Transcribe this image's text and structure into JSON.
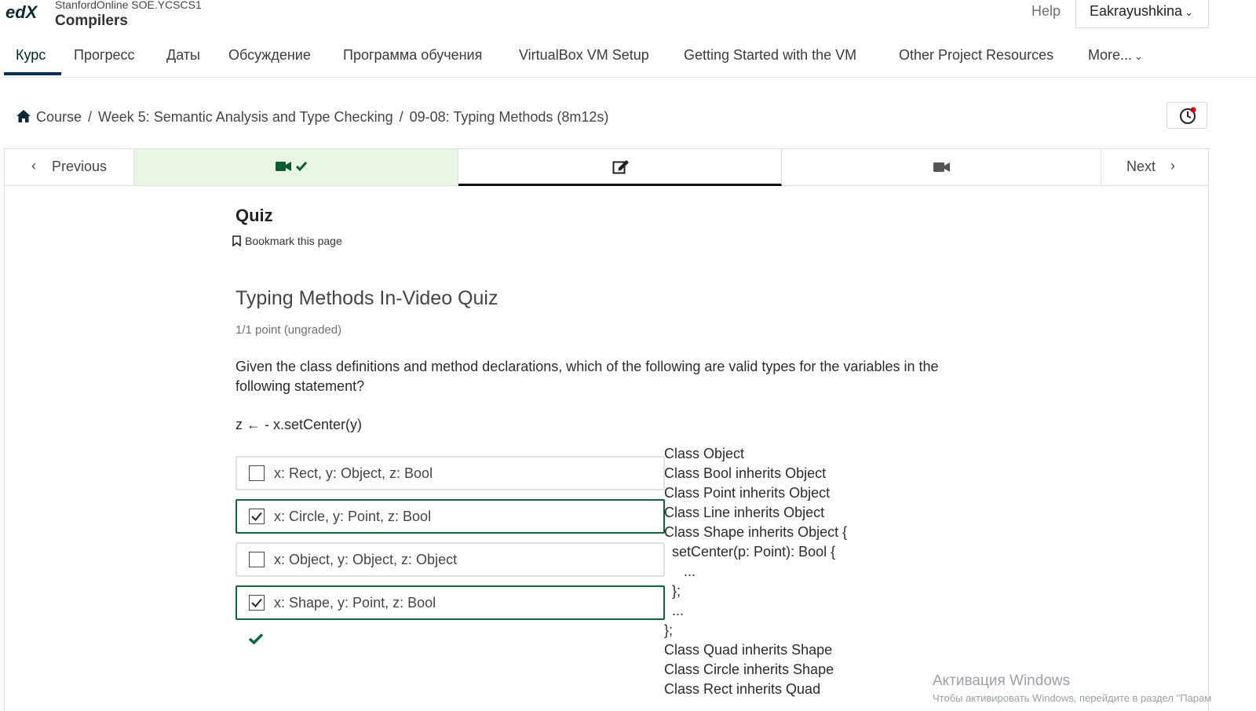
{
  "header": {
    "logo_text": "edX",
    "course_org": "StanfordOnline SOE.YCSCS1",
    "course_name": "Compilers",
    "help_label": "Help",
    "user_name": "Eakrayushkina"
  },
  "nav": {
    "tabs": [
      {
        "label": "Курс",
        "active": true
      },
      {
        "label": "Прогресс"
      },
      {
        "label": "Даты"
      },
      {
        "label": "Обсуждение"
      },
      {
        "label": "Программа обучения"
      },
      {
        "label": "VirtualBox VM Setup"
      },
      {
        "label": "Getting Started with the VM"
      },
      {
        "label": "Other Project Resources"
      },
      {
        "label": "More..."
      }
    ]
  },
  "breadcrumb": {
    "items": [
      "Course",
      "Week 5: Semantic Analysis and Type Checking",
      "09-08: Typing Methods (8m12s)"
    ],
    "separator": "/"
  },
  "sequence": {
    "previous_label": "Previous",
    "next_label": "Next",
    "units": [
      {
        "icon": "video-icon",
        "complete": true
      },
      {
        "icon": "edit-icon",
        "current": true
      },
      {
        "icon": "video-icon"
      }
    ]
  },
  "unit": {
    "title": "Quiz",
    "bookmark_label": "Bookmark this page"
  },
  "problem": {
    "title": "Typing Methods In-Video Quiz",
    "points": "1/1 point (ungraded)",
    "question": "Given the class definitions and method declarations, which of the following are valid types for the variables in the following statement?",
    "statement": "z ← - x.setCenter(y)",
    "choices": [
      {
        "label": "x: Rect, y: Object, z: Bool",
        "checked": false
      },
      {
        "label": "x: Circle, y: Point, z: Bool",
        "checked": true
      },
      {
        "label": "x: Object, y: Object, z: Object",
        "checked": false
      },
      {
        "label": "x: Shape, y: Point, z: Bool",
        "checked": true
      }
    ],
    "result": "correct",
    "code_lines": [
      "Class Object",
      "Class Bool inherits Object",
      "Class Point inherits Object",
      "Class Line inherits Object",
      "Class Shape inherits Object {",
      "  setCenter(p: Point): Bool {",
      "     ...",
      "  };",
      "  ...",
      "};",
      "Class Quad inherits Shape",
      "Class Circle inherits Shape",
      "Class Rect inherits Quad"
    ]
  },
  "colors": {
    "brand": "#00262b",
    "selected_border": "#11653a",
    "complete_bg": "#e9f6e5",
    "notification_dot": "#d0021b"
  },
  "watermark": {
    "line1": "Активация Windows",
    "line2": "Чтобы активировать Windows, перейдите в раздел \"Парам"
  }
}
